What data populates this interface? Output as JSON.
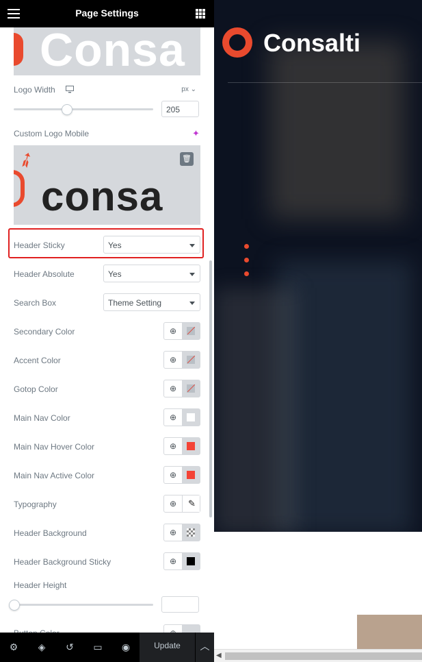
{
  "panel": {
    "title": "Page Settings",
    "logo_width": {
      "label": "Logo Width",
      "unit": "px ⌄",
      "value": "205",
      "slider_fraction": 0.37
    },
    "custom_logo_mobile": {
      "label": "Custom Logo Mobile",
      "preview_text": "consa"
    },
    "logo_preview_text": "Consa",
    "header_sticky": {
      "label": "Header Sticky",
      "value": "Yes"
    },
    "header_absolute": {
      "label": "Header Absolute",
      "value": "Yes"
    },
    "search_box": {
      "label": "Search Box",
      "value": "Theme Setting"
    },
    "colors": [
      {
        "label": "Secondary Color",
        "swatch": "empty"
      },
      {
        "label": "Accent Color",
        "swatch": "empty"
      },
      {
        "label": "Gotop Color",
        "swatch": "empty"
      },
      {
        "label": "Main Nav Color",
        "swatch": "#ffffff"
      },
      {
        "label": "Main Nav Hover Color",
        "swatch": "#f44336"
      },
      {
        "label": "Main Nav Active Color",
        "swatch": "#f44336"
      },
      {
        "label": "Typography",
        "swatch": "pencil"
      },
      {
        "label": "Header Background",
        "swatch": "checker"
      },
      {
        "label": "Header Background Sticky",
        "swatch": "#000000"
      }
    ],
    "header_height": {
      "label": "Header Height",
      "value": "",
      "slider_fraction": 0
    },
    "partial_label": "Button Color",
    "footer": {
      "update_label": "Update"
    }
  },
  "preview": {
    "brand_name": "Consalti",
    "accent": "#e94a2e"
  }
}
